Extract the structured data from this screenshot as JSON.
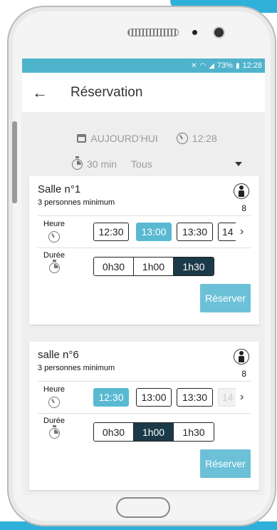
{
  "status": {
    "signal_text": "73%",
    "time": "12:28"
  },
  "appbar": {
    "title": "Réservation"
  },
  "filters": {
    "date": "AUJOURD'HUI",
    "time": "12:28",
    "duration": "30 min",
    "type": "Tous"
  },
  "rooms": [
    {
      "name": "Salle n°1",
      "subtitle": "3 personnes minimum",
      "capacity": "8",
      "hour_label": "Heure",
      "duration_label": "Durée",
      "times": [
        "12:30",
        "13:00",
        "13:30",
        "14"
      ],
      "selected_time": "13:00",
      "durations": [
        "0h30",
        "1h00",
        "1h30"
      ],
      "selected_duration": "1h30",
      "reserve_label": "Réserver"
    },
    {
      "name": "salle n°6",
      "subtitle": "3 personnes minimum",
      "capacity": "8",
      "hour_label": "Heure",
      "duration_label": "Durée",
      "times": [
        "12:30",
        "13:00",
        "13:30",
        "14"
      ],
      "selected_time": "12:30",
      "durations": [
        "0h30",
        "1h00",
        "1h30"
      ],
      "selected_duration": "1h00",
      "reserve_label": "Réserver"
    }
  ],
  "colors": {
    "accent": "#59b9d2",
    "dark_selected": "#1b3a49",
    "statusbar": "#4fb3cc"
  },
  "icons": [
    "back-arrow-icon",
    "calendar-icon",
    "clock-icon",
    "stopwatch-icon",
    "person-icon",
    "chevron-right-icon",
    "dropdown-caret-icon"
  ]
}
